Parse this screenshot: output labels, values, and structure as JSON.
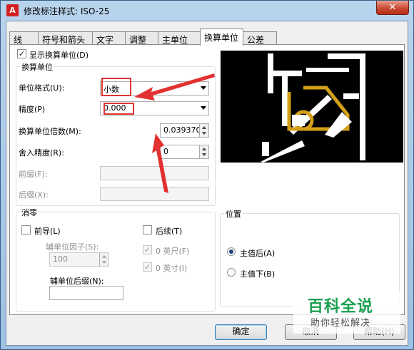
{
  "window": {
    "title": "修改标注样式: ISO-25",
    "close_glyph": "✕",
    "app_icon_letter": "A"
  },
  "tabs": [
    {
      "label": "线",
      "active": false
    },
    {
      "label": "符号和箭头",
      "active": false
    },
    {
      "label": "文字",
      "active": false
    },
    {
      "label": "调整",
      "active": false
    },
    {
      "label": "主单位",
      "active": false
    },
    {
      "label": "换算单位",
      "active": true
    },
    {
      "label": "公差",
      "active": false
    }
  ],
  "alt_units": {
    "show_label": "显示换算单位(D)",
    "show_checked": true,
    "group_title": "换算单位",
    "unit_format_label": "单位格式(U):",
    "unit_format_value": "小数",
    "precision_label": "精度(P)",
    "precision_value": "0.000",
    "multiplier_label": "换算单位倍数(M):",
    "multiplier_value": "0.0393700",
    "round_label": "舍入精度(R):",
    "round_value": "0",
    "prefix_label": "前缀(F):",
    "prefix_value": "",
    "suffix_label": "后缀(X):",
    "suffix_value": ""
  },
  "zero_suppression": {
    "group_title": "消零",
    "leading_label": "前导(L)",
    "leading_checked": false,
    "sub_units_factor_label": "辅单位因子(S):",
    "sub_units_factor_value": "100",
    "sub_units_suffix_label": "辅单位后缀(N):",
    "sub_units_suffix_value": "",
    "trailing_label": "后续(T)",
    "trailing_checked": false,
    "feet_label": "0 英尺(F)",
    "feet_checked": true,
    "inches_label": "0 英寸(I)",
    "inches_checked": true
  },
  "placement": {
    "group_title": "位置",
    "after_label": "主值后(A)",
    "after_selected": true,
    "below_label": "主值下(B)",
    "below_selected": false
  },
  "buttons": {
    "ok": "确定",
    "cancel": "取消",
    "help": "帮助(H)"
  },
  "watermark": {
    "main": "百科全说",
    "sub": "助你轻松解决"
  },
  "colors": {
    "annotation": "#e23131",
    "preview_accent": "#d4a018",
    "preview_bg": "#000000"
  }
}
